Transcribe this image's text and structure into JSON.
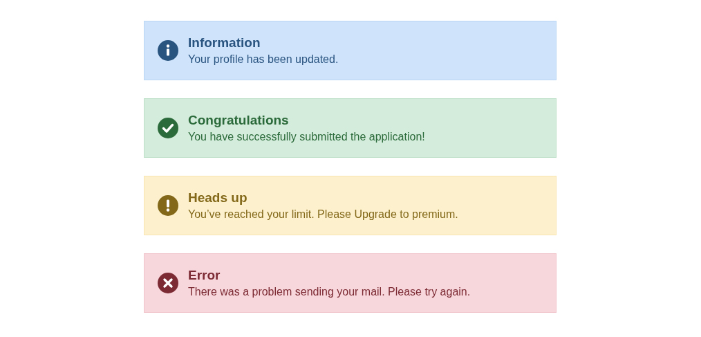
{
  "alerts": [
    {
      "kind": "info",
      "title": "Information",
      "message": "Your profile has been updated."
    },
    {
      "kind": "success",
      "title": "Congratulations",
      "message": "You have successfully submitted the application!"
    },
    {
      "kind": "warning",
      "title": "Heads up",
      "message": "You’ve reached your limit. Please Upgrade to premium."
    },
    {
      "kind": "error",
      "title": "Error",
      "message": "There was a problem sending your mail. Please try again."
    }
  ]
}
